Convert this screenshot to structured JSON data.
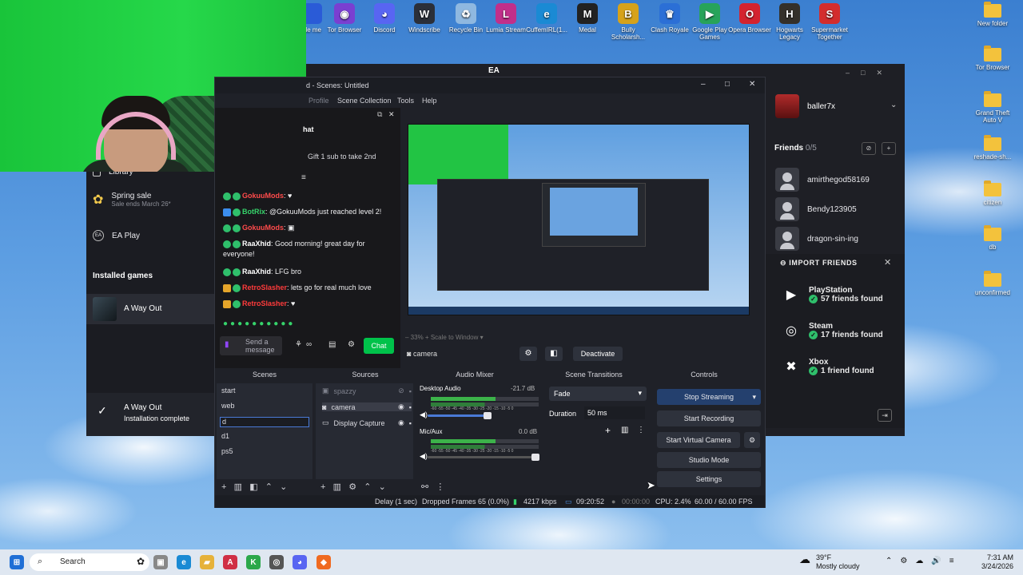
{
  "desktop": {
    "icons_top": [
      {
        "label": "Tor Browser",
        "color": "#7a3fd1",
        "glyph": "◉"
      },
      {
        "label": "Discord",
        "color": "#5865f2",
        "glyph": "◕"
      },
      {
        "label": "Windscribe",
        "color": "#2b2f39",
        "glyph": "W"
      },
      {
        "label": "Recycle Bin",
        "color": "#8fb8e0",
        "glyph": "♻"
      },
      {
        "label": "Lumia Stream",
        "color": "#c12f8a",
        "glyph": "L"
      },
      {
        "label": "CuffemIRL(1...",
        "color": "#1a8ad4",
        "glyph": "e"
      },
      {
        "label": "Medal",
        "color": "#222222",
        "glyph": "M"
      },
      {
        "label": "Bully Scholarsh...",
        "color": "#d6a21b",
        "glyph": "B"
      },
      {
        "label": "Clash Royale",
        "color": "#2b6fd6",
        "glyph": "♛"
      },
      {
        "label": "Google Play Games",
        "color": "#27a35a",
        "glyph": "▶"
      },
      {
        "label": "Opera Browser",
        "color": "#d4232f",
        "glyph": "O"
      },
      {
        "label": "Hogwarts Legacy",
        "color": "#34302a",
        "glyph": "H"
      },
      {
        "label": "Supermarket Together",
        "color": "#d32d2d",
        "glyph": "S"
      }
    ],
    "icons_right": [
      {
        "label": "New folder"
      },
      {
        "label": "Tor Browser"
      },
      {
        "label": "Grand Theft Auto V"
      },
      {
        "label": "reshade-sh..."
      },
      {
        "label": "citizen"
      },
      {
        "label": "db"
      },
      {
        "label": "unconfirmed"
      }
    ],
    "partial_icon_label": "gle me"
  },
  "ea": {
    "title": "EA",
    "left": {
      "library": "Library",
      "spring_sale": "Spring sale",
      "sale_ends": "Sale ends March 26*",
      "ea_play": "EA Play",
      "installed_games": "Installed games",
      "game": "A Way Out",
      "install_title": "A Way Out",
      "install_sub": "Installation complete"
    },
    "right": {
      "username": "baller7x",
      "friends_label": "Friends",
      "friends_count": "0/5",
      "friends": [
        "amirthegod58169",
        "Bendy123905",
        "dragon-sin-ing"
      ],
      "import_title": "IMPORT FRIENDS",
      "imports": [
        {
          "name": "PlayStation",
          "count": "57 friends found"
        },
        {
          "name": "Steam",
          "count": "17 friends found"
        },
        {
          "name": "Xbox",
          "count": "1 friend found"
        }
      ]
    }
  },
  "obs": {
    "title": "d - Scenes: Untitled",
    "menu": [
      "Profile",
      "Scene Collection",
      "Tools",
      "Help"
    ],
    "chat": {
      "header": "hat",
      "gift": "Gift 1 sub to take 2nd",
      "messages": [
        {
          "user": "GokuuMods",
          "color": "#ff4b4b",
          "text": ": ♥"
        },
        {
          "user": "BotRix",
          "color": "#36d36b",
          "text": ": @GokuuMods just reached level 2!"
        },
        {
          "user": "GokuuMods",
          "color": "#ff4b4b",
          "text": ": ▣"
        },
        {
          "user": "RaaXhid",
          "color": "#ffffff",
          "text": ": Good morning! great day for everyone!"
        },
        {
          "user": "RaaXhid",
          "color": "#ffffff",
          "text": ": LFG bro"
        },
        {
          "user": "RetroSlasher",
          "color": "#ff3b3b",
          "text": ": lets go for real much love"
        },
        {
          "user": "RetroSlasher",
          "color": "#ff3b3b",
          "text": ": ♥"
        }
      ],
      "input_placeholder": "Send a message",
      "chat_button": "Chat"
    },
    "preview_footer": {
      "zoom": "33%",
      "scale": "Scale to Window"
    },
    "source_bar": {
      "name": "camera",
      "deactivate": "Deactivate"
    },
    "docks": {
      "scenes": "Scenes",
      "sources": "Sources",
      "audio": "Audio Mixer",
      "transitions": "Scene Transitions",
      "controls": "Controls"
    },
    "scenes": [
      "start",
      "web",
      "d",
      "d1",
      "ps5"
    ],
    "sources": [
      "spazzy",
      "camera",
      "Display Capture"
    ],
    "audio": {
      "desktop_label": "Desktop Audio",
      "desktop_db": "-21.7 dB",
      "mic_label": "Mic/Aux",
      "mic_db": "0.0 dB",
      "scale": "-60 -55 -50 -45 -40 -35 -30 -25 -20 -15 -10 -5 0"
    },
    "transitions": {
      "type": "Fade",
      "duration_label": "Duration",
      "duration": "50 ms"
    },
    "controls": {
      "stop_streaming": "Stop Streaming",
      "start_recording": "Start Recording",
      "start_virtual_camera": "Start Virtual Camera",
      "studio_mode": "Studio Mode",
      "settings": "Settings"
    },
    "status": {
      "delay": "Delay (1 sec)",
      "dropped": "Dropped Frames 65 (0.0%)",
      "kbps": "4217 kbps",
      "stream_time": "09:20:52",
      "rec_time": "00:00:00",
      "cpu": "CPU: 2.4%",
      "fps": "60.00 / 60.00 FPS"
    }
  },
  "taskbar": {
    "search": "Search",
    "weather_temp": "39°F",
    "weather_desc": "Mostly cloudy",
    "time": "7:31 AM",
    "date": "3/24/2026"
  }
}
